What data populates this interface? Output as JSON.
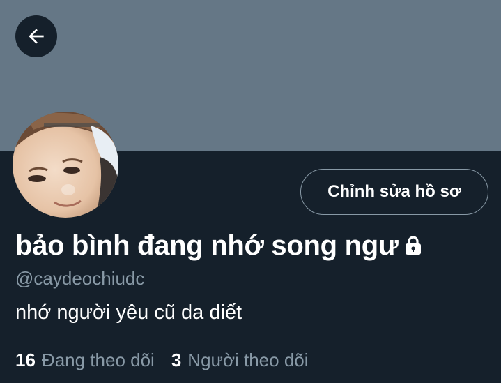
{
  "header": {
    "back_icon": "arrow-left-icon",
    "banner_color": "#657786"
  },
  "profile": {
    "avatar_alt": "avatar",
    "display_name": "bảo bình đang nhớ song ngư",
    "lock_icon": "lock-icon",
    "handle": "@caydeochiudc",
    "bio": "nhớ người yêu cũ da diết",
    "edit_button_label": "Chỉnh sửa hồ sơ"
  },
  "stats": {
    "following_count": "16",
    "following_label": "Đang theo dõi",
    "followers_count": "3",
    "followers_label": "Người theo dõi"
  },
  "colors": {
    "background": "#15202b",
    "secondary_text": "#8899a6",
    "primary_text": "#ffffff"
  }
}
